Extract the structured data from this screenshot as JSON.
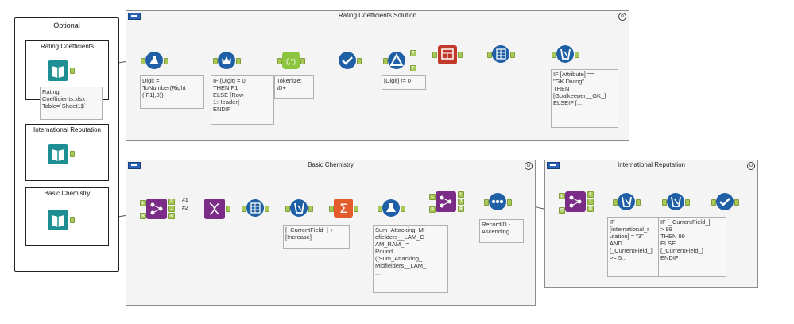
{
  "optional": {
    "title": "Optional",
    "inputs": [
      {
        "title": "Rating Coefficients",
        "annotation": "Rating\nCoefficients.xlsx\nTable=`Sheet1$`"
      },
      {
        "title": "International Reputation"
      },
      {
        "title": "Basic Chemistry"
      }
    ]
  },
  "containers": {
    "rating": {
      "title": "Rating Coefficients Solution",
      "collapse": "⊙"
    },
    "chemistry": {
      "title": "Basic Chemistry",
      "collapse": "⊙"
    },
    "reputation": {
      "title": "International Reputation",
      "collapse": "⊙"
    }
  },
  "annotations": {
    "digit_formula": "Digit =\nToNumber(Right\n([F1],3))",
    "header_formula": "IF [Digit] = 0\nTHEN F1\nELSE [Row-\n1:Header]\nENDIF",
    "tokenize": "Tokenize:\n\\D+",
    "digit_filter": "[Digit] != 0",
    "attribute_formula": "IF [Attribute] ==\n\"GK Diving\"\nTHEN\n[Goalkeeper__GK_]\nELSEIF [...",
    "increase_formula": "[_CurrentField_] +\n[Increase]",
    "sum_formula": "Sum_Attacking_Mi\ndfielders__LAM_C\nAM_RAM_ =\nRound\n([Sum_Attacking_\nMidfielders__LAM_\n...",
    "sort": "RecordID -\nAscending",
    "rep_formula_1": "IF\n[international_r\nutation] = \"3\"\nAND\n[_CurrentField_]\n>= 5...",
    "rep_formula_2": "IF [_CurrentField_]\n> 99\nTHEN 99\nELSE\n[_CurrentField_]\nENDIF"
  },
  "wire_labels": {
    "first": "#1",
    "second": "#2"
  },
  "anchor_labels": {
    "true": "T",
    "false": "F",
    "left": "L",
    "join": "J",
    "right": "R",
    "input_1": "1",
    "input_2": "2"
  },
  "colors": {
    "in_out": "#1d8f92",
    "preparation": "#1f5fa6",
    "join": "#7b2c86",
    "parse": "#8cc63f",
    "summarize": "#e35a2b",
    "reporting": "#c0392b",
    "anchor": "#a8c85a",
    "container_bg": "#f4f4f4"
  },
  "icons": {
    "input": "book-icon",
    "formula": "flask-icon",
    "multirow": "crown-icon",
    "regex": "regex-icon",
    "select": "checkmark-icon",
    "filter": "triangle-icon",
    "table": "table-icon",
    "transpose": "grid-icon",
    "multifield": "beaker-icon",
    "join": "join-icon",
    "dna": "dna-icon",
    "summarize": "sigma-icon",
    "sort": "dots-icon"
  }
}
